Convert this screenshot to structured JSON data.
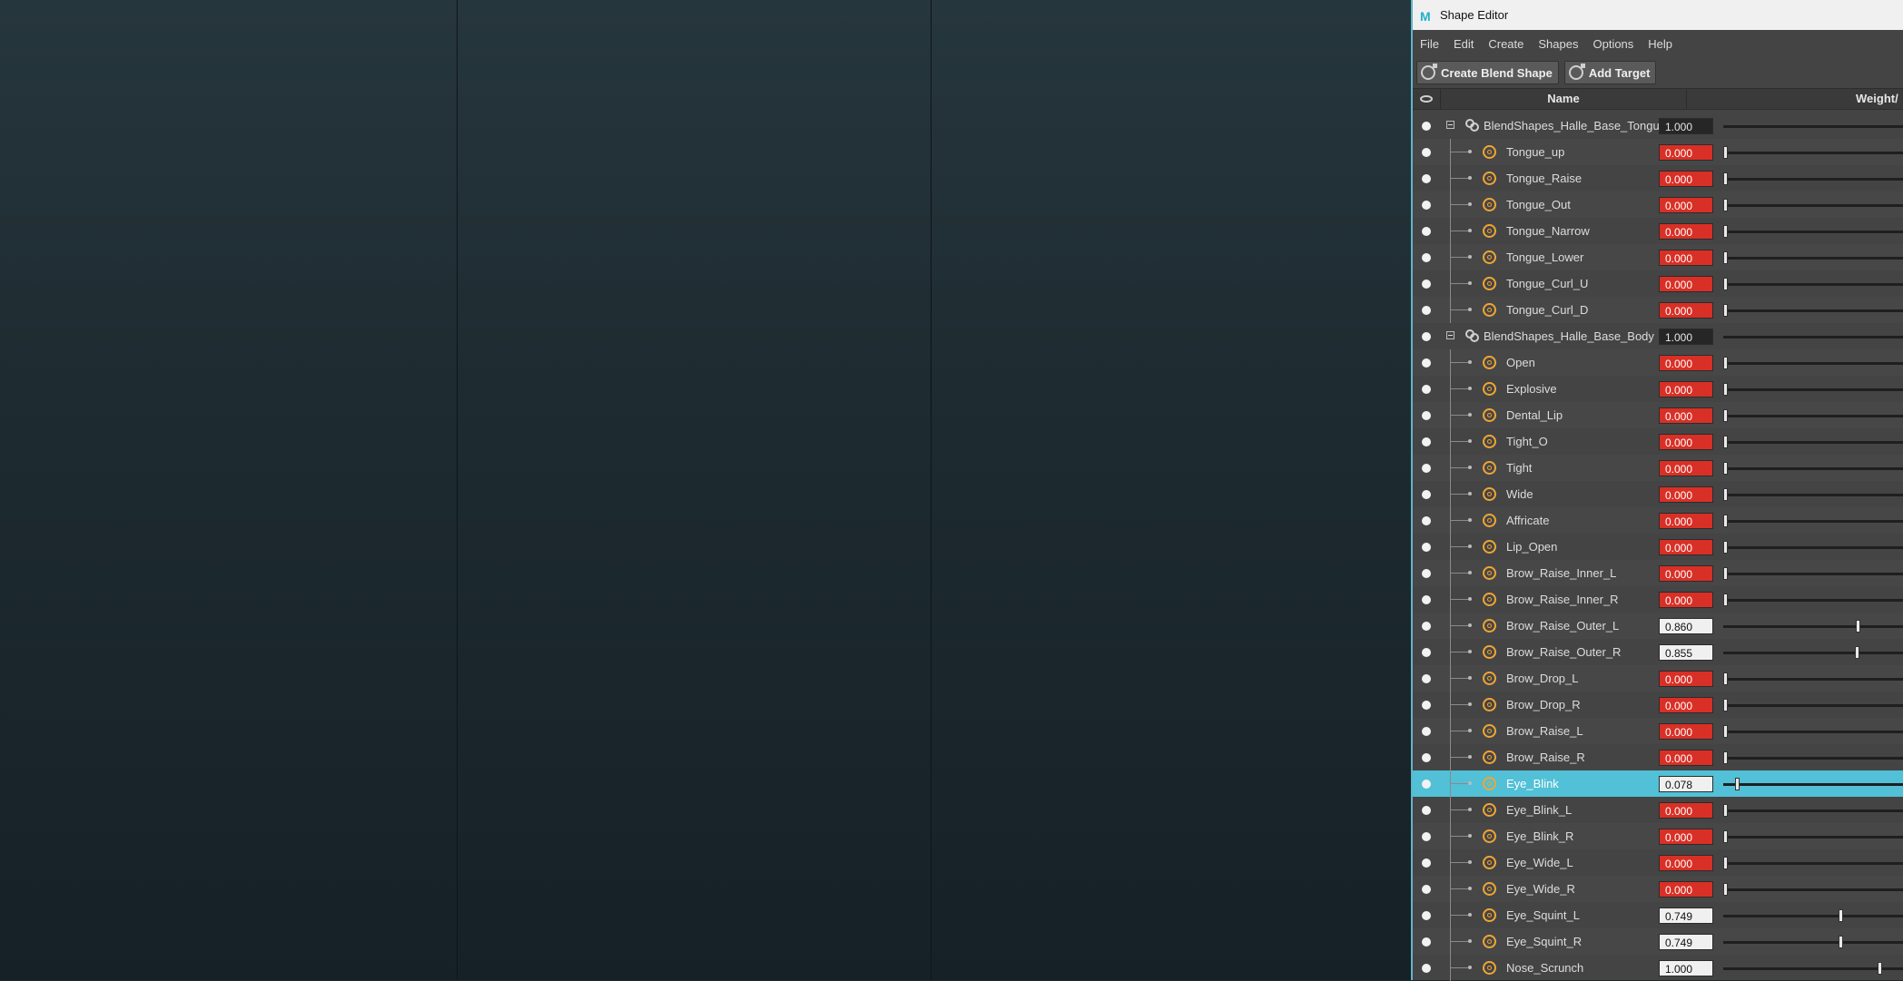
{
  "editor": {
    "window_title": "Shape Editor",
    "menu": [
      "File",
      "Edit",
      "Create",
      "Shapes",
      "Options",
      "Help"
    ],
    "toolbar": {
      "create_blend_shape": "Create Blend Shape",
      "add_target": "Add Target"
    },
    "columns": {
      "name": "Name",
      "weight": "Weight/"
    },
    "colors": {
      "accent": "#52c0d6",
      "zero_value": "#d83026",
      "target_icon": "#f0a534"
    },
    "rows": [
      {
        "kind": "group",
        "name": "BlendShapes_Halle_Base_Tongue",
        "value": "1.000"
      },
      {
        "kind": "target",
        "name": "Tongue_up",
        "value": "0.000"
      },
      {
        "kind": "target",
        "name": "Tongue_Raise",
        "value": "0.000"
      },
      {
        "kind": "target",
        "name": "Tongue_Out",
        "value": "0.000"
      },
      {
        "kind": "target",
        "name": "Tongue_Narrow",
        "value": "0.000"
      },
      {
        "kind": "target",
        "name": "Tongue_Lower",
        "value": "0.000"
      },
      {
        "kind": "target",
        "name": "Tongue_Curl_U",
        "value": "0.000"
      },
      {
        "kind": "target",
        "name": "Tongue_Curl_D",
        "value": "0.000"
      },
      {
        "kind": "group",
        "name": "BlendShapes_Halle_Base_Body",
        "value": "1.000"
      },
      {
        "kind": "target",
        "name": "Open",
        "value": "0.000"
      },
      {
        "kind": "target",
        "name": "Explosive",
        "value": "0.000"
      },
      {
        "kind": "target",
        "name": "Dental_Lip",
        "value": "0.000"
      },
      {
        "kind": "target",
        "name": "Tight_O",
        "value": "0.000"
      },
      {
        "kind": "target",
        "name": "Tight",
        "value": "0.000"
      },
      {
        "kind": "target",
        "name": "Wide",
        "value": "0.000"
      },
      {
        "kind": "target",
        "name": "Affricate",
        "value": "0.000"
      },
      {
        "kind": "target",
        "name": "Lip_Open",
        "value": "0.000"
      },
      {
        "kind": "target",
        "name": "Brow_Raise_Inner_L",
        "value": "0.000"
      },
      {
        "kind": "target",
        "name": "Brow_Raise_Inner_R",
        "value": "0.000"
      },
      {
        "kind": "target",
        "name": "Brow_Raise_Outer_L",
        "value": "0.860"
      },
      {
        "kind": "target",
        "name": "Brow_Raise_Outer_R",
        "value": "0.855"
      },
      {
        "kind": "target",
        "name": "Brow_Drop_L",
        "value": "0.000"
      },
      {
        "kind": "target",
        "name": "Brow_Drop_R",
        "value": "0.000"
      },
      {
        "kind": "target",
        "name": "Brow_Raise_L",
        "value": "0.000"
      },
      {
        "kind": "target",
        "name": "Brow_Raise_R",
        "value": "0.000"
      },
      {
        "kind": "target",
        "name": "Eye_Blink",
        "value": "0.078",
        "selected": true
      },
      {
        "kind": "target",
        "name": "Eye_Blink_L",
        "value": "0.000"
      },
      {
        "kind": "target",
        "name": "Eye_Blink_R",
        "value": "0.000"
      },
      {
        "kind": "target",
        "name": "Eye_Wide_L",
        "value": "0.000"
      },
      {
        "kind": "target",
        "name": "Eye_Wide_R",
        "value": "0.000"
      },
      {
        "kind": "target",
        "name": "Eye_Squint_L",
        "value": "0.749"
      },
      {
        "kind": "target",
        "name": "Eye_Squint_R",
        "value": "0.749"
      },
      {
        "kind": "target",
        "name": "Nose_Scrunch",
        "value": "1.000"
      }
    ]
  }
}
